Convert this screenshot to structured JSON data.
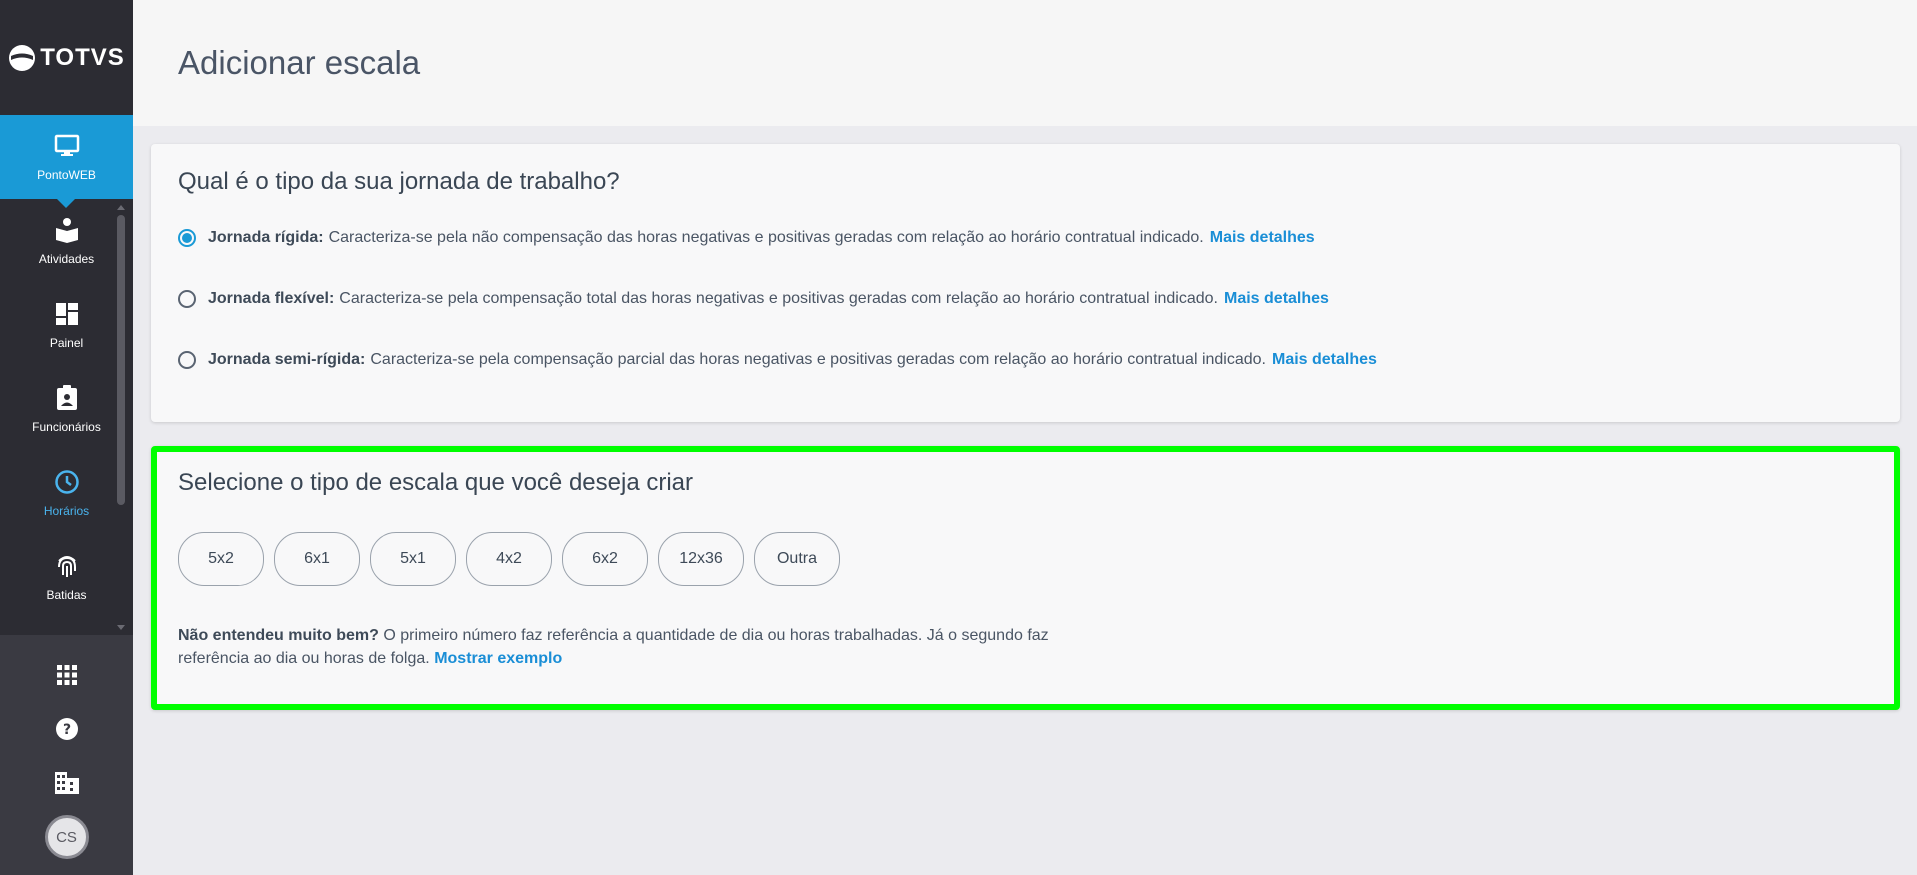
{
  "brand": {
    "name": "TOTVS"
  },
  "sidebar": {
    "items": [
      {
        "label": "PontoWEB",
        "icon": "monitor-icon"
      },
      {
        "label": "Atividades",
        "icon": "reading-icon"
      },
      {
        "label": "Painel",
        "icon": "dashboard-icon"
      },
      {
        "label": "Funcionários",
        "icon": "badge-icon"
      },
      {
        "label": "Horários",
        "icon": "clock-icon"
      },
      {
        "label": "Batidas",
        "icon": "fingerprint-icon"
      }
    ],
    "bottom": {
      "apps_icon": "apps-grid-icon",
      "help_icon": "help-icon",
      "company_icon": "building-icon",
      "avatar_initials": "CS"
    }
  },
  "header": {
    "title": "Adicionar escala"
  },
  "journey": {
    "title": "Qual é o tipo da sua jornada de trabalho?",
    "options": [
      {
        "name": "Jornada rígida:",
        "description": "Caracteriza-se pela não compensação das horas negativas e positivas geradas com relação ao horário contratual indicado.",
        "link": "Mais detalhes",
        "checked": true
      },
      {
        "name": "Jornada flexível:",
        "description": "Caracteriza-se pela compensação total das horas negativas e positivas geradas com relação ao horário contratual indicado.",
        "link": "Mais detalhes",
        "checked": false
      },
      {
        "name": "Jornada semi-rígida:",
        "description": "Caracteriza-se pela compensação parcial das horas negativas e positivas geradas com relação ao horário contratual indicado.",
        "link": "Mais detalhes",
        "checked": false
      }
    ]
  },
  "scale": {
    "title": "Selecione o tipo de escala que você deseja criar",
    "chips": [
      "5x2",
      "6x1",
      "5x1",
      "4x2",
      "6x2",
      "12x36",
      "Outra"
    ],
    "help_bold": "Não entendeu muito bem?",
    "help_text": "O primeiro número faz referência a quantidade de dia ou horas trabalhadas. Já o segundo faz referência ao dia ou horas de folga.",
    "help_link": "Mostrar exemplo"
  },
  "colors": {
    "accent": "#1a9ad6",
    "highlight": "#00ff00",
    "sidebar": "#2c2c33"
  }
}
